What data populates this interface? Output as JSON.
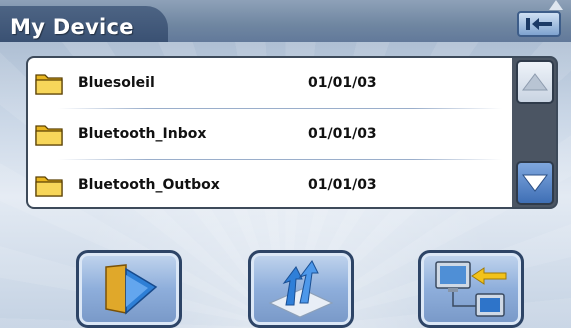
{
  "window": {
    "title": "My Device"
  },
  "file_list": {
    "items": [
      {
        "icon": "folder-icon",
        "name": "Bluesoleil",
        "date": "01/01/03"
      },
      {
        "icon": "folder-icon",
        "name": "Bluetooth_Inbox",
        "date": "01/01/03"
      },
      {
        "icon": "folder-icon",
        "name": "Bluetooth_Outbox",
        "date": "01/01/03"
      }
    ]
  },
  "toolbar": {
    "exit_icon": "exit-arrow-icon",
    "scroll_up_icon": "arrow-up-icon",
    "scroll_down_icon": "arrow-down-icon",
    "buttons": [
      {
        "icon": "open-folder-icon"
      },
      {
        "icon": "transfer-arrows-icon"
      },
      {
        "icon": "computer-sync-icon"
      }
    ]
  },
  "colors": {
    "title_bar": "#3a5173",
    "accent": "#7898c7",
    "list_frame": "#3d4a5a"
  }
}
